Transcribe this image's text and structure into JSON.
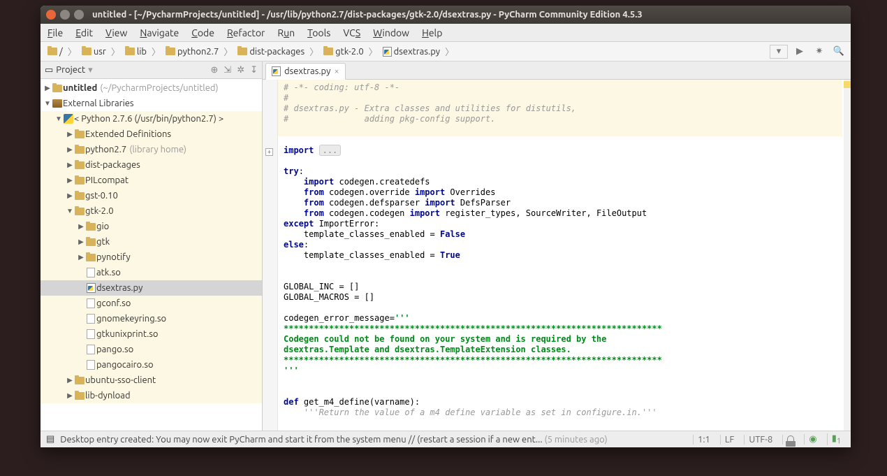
{
  "window": {
    "title": "untitled - [~/PycharmProjects/untitled] - /usr/lib/python2.7/dist-packages/gtk-2.0/dsextras.py - PyCharm Community Edition 4.5.3"
  },
  "menu": [
    "File",
    "Edit",
    "View",
    "Navigate",
    "Code",
    "Refactor",
    "Run",
    "Tools",
    "VCS",
    "Window",
    "Help"
  ],
  "breadcrumb": [
    "/",
    "usr",
    "lib",
    "python2.7",
    "dist-packages",
    "gtk-2.0",
    "dsextras.py"
  ],
  "project_panel": {
    "title": "Project",
    "root": {
      "name": "untitled",
      "path": "(~/PycharmProjects/untitled)"
    },
    "ext_lib_label": "External Libraries",
    "python_label": "< Python 2.7.6 (/usr/bin/python2.7) >",
    "folders_closed": [
      "Extended Definitions",
      "python2.7",
      "dist-packages",
      "PILcompat",
      "gst-0.10"
    ],
    "python27_suffix": "(library home)",
    "gtk_folder": "gtk-2.0",
    "gtk_subfolders": [
      "gio",
      "gtk",
      "pynotify"
    ],
    "gtk_files": [
      "atk.so",
      "dsextras.py",
      "gconf.so",
      "gnomekeyring.so",
      "gtkunixprint.so",
      "pango.so",
      "pangocairo.so"
    ],
    "selected_file": "dsextras.py",
    "bottom_folders": [
      "ubuntu-sso-client",
      "lib-dynload"
    ]
  },
  "tab": {
    "label": "dsextras.py"
  },
  "code": {
    "l1": "# -*- coding: utf-8 -*-",
    "l2": "#",
    "l3": "# dsextras.py - Extra classes and utilities for distutils,",
    "l4": "#               adding pkg-config support.",
    "l7": "import",
    "l7b": "...",
    "try": "try",
    "l9": "    import",
    "l9b": " codegen.createdefs",
    "l10": "    from",
    "l10b": " codegen.override ",
    "l10c": "import",
    "l10d": " Overrides",
    "l11": "    from",
    "l11b": " codegen.defsparser ",
    "l11c": "import",
    "l11d": " DefsParser",
    "l12": "    from",
    "l12b": " codegen.codegen ",
    "l12c": "import",
    "l12d": " register_types, SourceWriter, FileOutput",
    "except": "except",
    "l13b": " ImportError:",
    "l14": "    template_classes_enabled = ",
    "false": "False",
    "else": "else",
    "l16": "    template_classes_enabled = ",
    "true": "True",
    "l19": "GLOBAL_INC = []",
    "l20": "GLOBAL_MACROS = []",
    "l22": "codegen_error_message=",
    "l22b": "'''",
    "l23": "***************************************************************************",
    "l24": "Codegen could not be found on your system and is required by the",
    "l25": "dsextras.Template and dsextras.TemplateExtension classes.",
    "l26": "***************************************************************************",
    "l27": "'''",
    "def": "def",
    "l29b": " get_m4_define(varname):",
    "l30": "    '''Return the value of a m4 define variable as set in configure.in.'''"
  },
  "status": {
    "icon": "▤",
    "msg": "Desktop entry created: You may now exit PyCharm and start it from the system menu // (restart a session if a new ent...",
    "time": "(5 minutes ago)",
    "pos": "1:1",
    "le": "LF",
    "enc": "UTF-8"
  }
}
